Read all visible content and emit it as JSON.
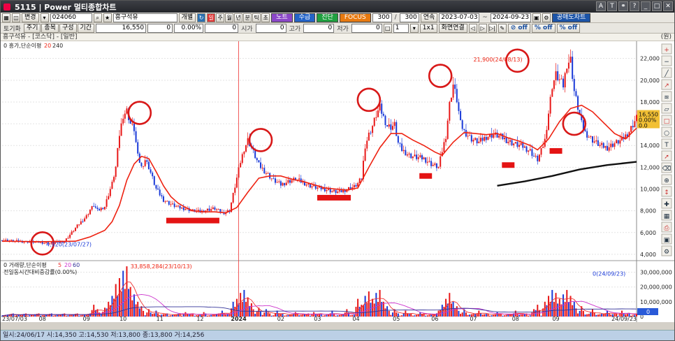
{
  "window": {
    "title": "5115 | Power 멀티종합차트"
  },
  "toolbar1": {
    "view_label": "변경",
    "code": "024060",
    "name": "흥구석유",
    "search_btn": "개별",
    "period_buttons": [
      "일",
      "주",
      "월",
      "년",
      "분",
      "틱",
      "초"
    ],
    "nodes_btn": "노트",
    "supply_btn": "수급",
    "diag_btn": "진단",
    "focus_btn": "FOCUS",
    "count_a": "300",
    "count_b": "300",
    "link_btn": "연속",
    "date_from": "2023-07-03",
    "date_to": "2024-09-23",
    "trade_btn": "공매도차트"
  },
  "toolbar2": {
    "tabs": [
      "주기",
      "종목",
      "구성",
      "기간"
    ],
    "price": "16,550",
    "change": "0",
    "rate": "0.00%",
    "v0": "0",
    "open_label": "시가",
    "open_val": "0",
    "high_label": "고가",
    "high_val": "0",
    "low_label": "저가",
    "low_val": "0",
    "spin_val": "1",
    "ratio_label": "1x1",
    "screen_btn": "화면연결",
    "toggle1": "off",
    "toggle2": "off",
    "toggle3": "off"
  },
  "chart_header": {
    "stock_line": "흥구석유 - [코스닥] - [일반]",
    "unit": "(원)"
  },
  "chart_data": {
    "type": "candlestick",
    "price_panel": {
      "legend_name": "흥가,단순이평",
      "ma_periods": [
        "20",
        "240"
      ],
      "yticks": [
        4000,
        6000,
        8000,
        10000,
        12000,
        14000,
        16000,
        18000,
        20000,
        22000
      ],
      "ytick_labels": [
        "4,000",
        "6,000",
        "8,000",
        "10,000",
        "12,000",
        "14,000",
        "16,000",
        "18,000",
        "20,000",
        "22,000"
      ],
      "ylim": [
        3800,
        23200
      ],
      "high_annotation": "21,900(24/08/13)",
      "low_annotation": "4,920(23/07/27)",
      "current_price": "16,550",
      "current_rate": "0.00%",
      "current_change": "0.0",
      "price_trend": [
        [
          0,
          5300
        ],
        [
          8,
          5200
        ],
        [
          14,
          5150
        ],
        [
          20,
          5100
        ],
        [
          26,
          5000
        ],
        [
          30,
          5100
        ],
        [
          34,
          5200
        ],
        [
          38,
          6000
        ],
        [
          42,
          6800
        ],
        [
          46,
          7500
        ],
        [
          48,
          8100
        ],
        [
          50,
          8500
        ],
        [
          52,
          8000
        ],
        [
          56,
          8400
        ],
        [
          58,
          9500
        ],
        [
          60,
          10500
        ],
        [
          62,
          12000
        ],
        [
          64,
          15000
        ],
        [
          66,
          16800
        ],
        [
          68,
          17200
        ],
        [
          70,
          16000
        ],
        [
          72,
          15500
        ],
        [
          74,
          13000
        ],
        [
          76,
          12000
        ],
        [
          78,
          12700
        ],
        [
          80,
          12000
        ],
        [
          84,
          10000
        ],
        [
          88,
          9000
        ],
        [
          92,
          8600
        ],
        [
          96,
          8300
        ],
        [
          100,
          8200
        ],
        [
          104,
          8000
        ],
        [
          108,
          7900
        ],
        [
          112,
          8100
        ],
        [
          116,
          8200
        ],
        [
          120,
          7800
        ],
        [
          124,
          8000
        ],
        [
          126,
          9500
        ],
        [
          128,
          11000
        ],
        [
          130,
          12500
        ],
        [
          132,
          13700
        ],
        [
          134,
          14500
        ],
        [
          136,
          13800
        ],
        [
          138,
          13000
        ],
        [
          140,
          12200
        ],
        [
          144,
          11500
        ],
        [
          148,
          10800
        ],
        [
          152,
          10400
        ],
        [
          156,
          10700
        ],
        [
          160,
          10900
        ],
        [
          164,
          10600
        ],
        [
          168,
          10300
        ],
        [
          172,
          10100
        ],
        [
          176,
          10000
        ],
        [
          180,
          9800
        ],
        [
          184,
          9700
        ],
        [
          188,
          10000
        ],
        [
          192,
          10200
        ],
        [
          194,
          10500
        ],
        [
          196,
          11000
        ],
        [
          198,
          14000
        ],
        [
          200,
          15000
        ],
        [
          202,
          15800
        ],
        [
          204,
          16800
        ],
        [
          206,
          17500
        ],
        [
          208,
          16600
        ],
        [
          210,
          15800
        ],
        [
          212,
          15700
        ],
        [
          214,
          15900
        ],
        [
          216,
          14200
        ],
        [
          218,
          13600
        ],
        [
          222,
          13100
        ],
        [
          226,
          12900
        ],
        [
          230,
          12800
        ],
        [
          234,
          12300
        ],
        [
          238,
          12000
        ],
        [
          240,
          13500
        ],
        [
          242,
          14900
        ],
        [
          244,
          17800
        ],
        [
          246,
          19600
        ],
        [
          248,
          18200
        ],
        [
          250,
          16000
        ],
        [
          252,
          15300
        ],
        [
          256,
          14600
        ],
        [
          260,
          14300
        ],
        [
          264,
          14800
        ],
        [
          268,
          15000
        ],
        [
          272,
          14800
        ],
        [
          276,
          14400
        ],
        [
          280,
          14100
        ],
        [
          284,
          13900
        ],
        [
          288,
          13500
        ],
        [
          290,
          13000
        ],
        [
          292,
          12700
        ],
        [
          294,
          13500
        ],
        [
          296,
          14500
        ],
        [
          298,
          17000
        ],
        [
          300,
          19500
        ],
        [
          302,
          20500
        ],
        [
          304,
          20000
        ],
        [
          306,
          19500
        ],
        [
          308,
          21500
        ],
        [
          310,
          21900
        ],
        [
          312,
          19000
        ],
        [
          314,
          17500
        ],
        [
          316,
          16000
        ],
        [
          318,
          15200
        ],
        [
          322,
          14500
        ],
        [
          326,
          14000
        ],
        [
          330,
          13800
        ],
        [
          334,
          14200
        ],
        [
          338,
          14500
        ],
        [
          342,
          15300
        ],
        [
          346,
          16550
        ]
      ],
      "ma20_trend": [
        [
          0,
          5200
        ],
        [
          20,
          5150
        ],
        [
          40,
          5200
        ],
        [
          48,
          5600
        ],
        [
          56,
          6200
        ],
        [
          60,
          7000
        ],
        [
          64,
          8500
        ],
        [
          68,
          10800
        ],
        [
          72,
          12300
        ],
        [
          76,
          13000
        ],
        [
          80,
          12800
        ],
        [
          84,
          11600
        ],
        [
          88,
          10300
        ],
        [
          92,
          9300
        ],
        [
          96,
          8700
        ],
        [
          100,
          8300
        ],
        [
          104,
          8000
        ],
        [
          110,
          7900
        ],
        [
          116,
          7900
        ],
        [
          122,
          7800
        ],
        [
          128,
          8300
        ],
        [
          134,
          9700
        ],
        [
          140,
          11000
        ],
        [
          146,
          11200
        ],
        [
          152,
          11200
        ],
        [
          158,
          10900
        ],
        [
          164,
          10700
        ],
        [
          170,
          10400
        ],
        [
          176,
          10100
        ],
        [
          182,
          10000
        ],
        [
          188,
          9900
        ],
        [
          194,
          10100
        ],
        [
          200,
          12000
        ],
        [
          206,
          13800
        ],
        [
          212,
          15100
        ],
        [
          218,
          15100
        ],
        [
          224,
          14500
        ],
        [
          230,
          14000
        ],
        [
          236,
          13400
        ],
        [
          240,
          13100
        ],
        [
          246,
          14300
        ],
        [
          252,
          15200
        ],
        [
          258,
          15100
        ],
        [
          264,
          15000
        ],
        [
          270,
          15100
        ],
        [
          276,
          14700
        ],
        [
          282,
          14400
        ],
        [
          288,
          14000
        ],
        [
          292,
          13600
        ],
        [
          298,
          14600
        ],
        [
          304,
          16200
        ],
        [
          310,
          17400
        ],
        [
          316,
          17700
        ],
        [
          322,
          17100
        ],
        [
          328,
          16100
        ],
        [
          334,
          15100
        ],
        [
          340,
          14600
        ],
        [
          346,
          15600
        ]
      ],
      "ma240_trend": [
        [
          270,
          10300
        ],
        [
          285,
          10700
        ],
        [
          300,
          11200
        ],
        [
          315,
          11800
        ],
        [
          330,
          12200
        ],
        [
          346,
          12500
        ]
      ]
    },
    "volume_panel": {
      "legend_name": "거래량,단순이평",
      "ma_periods": [
        "5",
        "20",
        "60"
      ],
      "sub_legend": "전일동시간대비증감률(0.00%)",
      "yticks": [
        0,
        10000000,
        20000000,
        30000000
      ],
      "ytick_labels": [
        "0",
        "10,000,000",
        "20,000,000",
        "30,000,000"
      ],
      "max_annotation": "33,858,284(23/10/13)",
      "last_annotation": "0(24/09/23)",
      "current_volume": "0",
      "bursts": [
        [
          50,
          8
        ],
        [
          52,
          5
        ],
        [
          56,
          6
        ],
        [
          58,
          10
        ],
        [
          60,
          14
        ],
        [
          62,
          22
        ],
        [
          64,
          26
        ],
        [
          66,
          31
        ],
        [
          68,
          34
        ],
        [
          70,
          20
        ],
        [
          72,
          15
        ],
        [
          74,
          10
        ],
        [
          76,
          7
        ],
        [
          80,
          5
        ],
        [
          84,
          4
        ],
        [
          100,
          3
        ],
        [
          110,
          3
        ],
        [
          120,
          4
        ],
        [
          126,
          10
        ],
        [
          128,
          12
        ],
        [
          130,
          16
        ],
        [
          132,
          18
        ],
        [
          134,
          13
        ],
        [
          136,
          9
        ],
        [
          140,
          6
        ],
        [
          144,
          5
        ],
        [
          150,
          4
        ],
        [
          160,
          3
        ],
        [
          170,
          3
        ],
        [
          180,
          4
        ],
        [
          188,
          5
        ],
        [
          194,
          12
        ],
        [
          196,
          8
        ],
        [
          198,
          14
        ],
        [
          200,
          17
        ],
        [
          202,
          12
        ],
        [
          204,
          16
        ],
        [
          206,
          18
        ],
        [
          208,
          10
        ],
        [
          210,
          7
        ],
        [
          214,
          5
        ],
        [
          220,
          4
        ],
        [
          228,
          3
        ],
        [
          238,
          4
        ],
        [
          240,
          8
        ],
        [
          242,
          12
        ],
        [
          244,
          16
        ],
        [
          246,
          10
        ],
        [
          248,
          7
        ],
        [
          252,
          5
        ],
        [
          260,
          4
        ],
        [
          270,
          3
        ],
        [
          280,
          4
        ],
        [
          290,
          5
        ],
        [
          292,
          8
        ],
        [
          296,
          10
        ],
        [
          298,
          14
        ],
        [
          300,
          18
        ],
        [
          302,
          16
        ],
        [
          304,
          12
        ],
        [
          306,
          15
        ],
        [
          308,
          18
        ],
        [
          310,
          14
        ],
        [
          312,
          10
        ],
        [
          316,
          7
        ],
        [
          322,
          5
        ],
        [
          330,
          4
        ],
        [
          338,
          4
        ],
        [
          346,
          2
        ]
      ]
    },
    "xticks": [
      {
        "i": 0,
        "label": "23/07/03"
      },
      {
        "i": 22,
        "label": "08"
      },
      {
        "i": 46,
        "label": "09"
      },
      {
        "i": 66,
        "label": "10"
      },
      {
        "i": 86,
        "label": "11"
      },
      {
        "i": 108,
        "label": "12"
      },
      {
        "i": 129,
        "label": "2024"
      },
      {
        "i": 152,
        "label": "02"
      },
      {
        "i": 172,
        "label": "03"
      },
      {
        "i": 193,
        "label": "04"
      },
      {
        "i": 215,
        "label": "05"
      },
      {
        "i": 236,
        "label": "06"
      },
      {
        "i": 257,
        "label": "07"
      },
      {
        "i": 280,
        "label": "08"
      },
      {
        "i": 302,
        "label": "09"
      },
      {
        "i": 346,
        "label": "24/09/23"
      }
    ],
    "n_days": 347,
    "year_divider_i": 129,
    "annotations_circles": [
      [
        22,
        5000
      ],
      [
        75,
        17000
      ],
      [
        141,
        14500
      ],
      [
        200,
        18200
      ],
      [
        239,
        20400
      ],
      [
        281,
        21800
      ],
      [
        312,
        16000
      ]
    ],
    "annotations_bars": [
      [
        104,
        7100
      ],
      [
        181,
        9200
      ],
      [
        231,
        11200
      ],
      [
        276,
        12200
      ],
      [
        302,
        13500
      ]
    ]
  },
  "statusbar": {
    "text": "일시:24/06/17 시:14,350 고:14,530 저:13,800 종:13,800 거:14,256"
  },
  "right_icons": [
    "zoom-in-icon",
    "zoom-out-icon",
    "line-tool-icon",
    "trend-icon",
    "fibo-icon",
    "channel-icon",
    "rect-icon",
    "ellipse-icon",
    "text-icon",
    "arrow-icon",
    "eraser-icon",
    "magnet-icon",
    "scroll-icon",
    "crosshair-icon",
    "grid-icon",
    "print-icon",
    "save-icon",
    "settings-icon"
  ]
}
